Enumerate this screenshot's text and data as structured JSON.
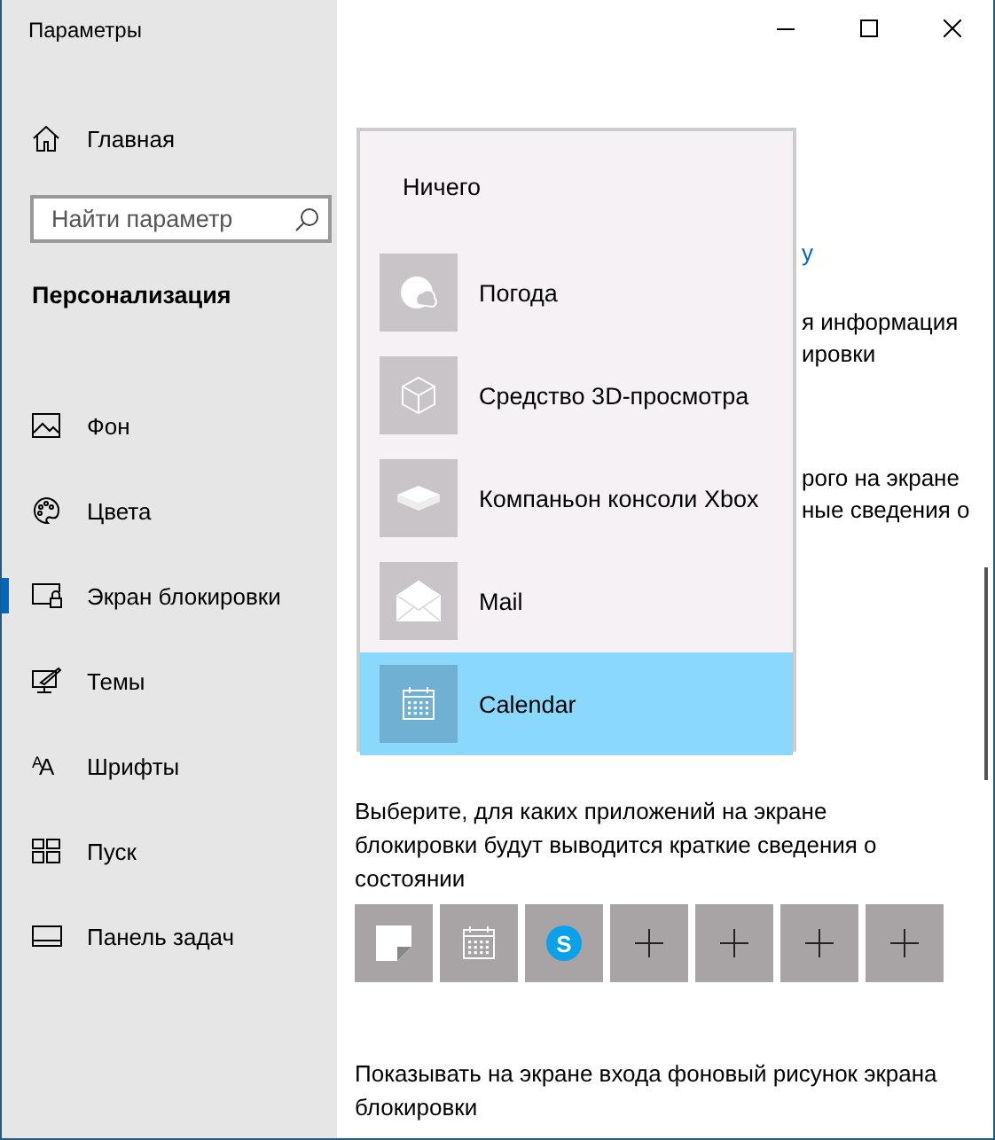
{
  "window": {
    "title": "Параметры"
  },
  "sidebar": {
    "home": {
      "label": "Главная"
    },
    "search": {
      "placeholder": "Найти параметр"
    },
    "section_title": "Персонализация",
    "items": [
      {
        "label": "Фон",
        "selected": false
      },
      {
        "label": "Цвета",
        "selected": false
      },
      {
        "label": "Экран блокировки",
        "selected": true
      },
      {
        "label": "Темы",
        "selected": false
      },
      {
        "label": "Шрифты",
        "selected": false,
        "glyph": "AA"
      },
      {
        "label": "Пуск",
        "selected": false
      },
      {
        "label": "Панель задач",
        "selected": false
      }
    ]
  },
  "content": {
    "link_fragment": "у",
    "fragments": [
      "я информация",
      "ировки",
      "рого на экране",
      "ные сведения о"
    ],
    "status_text": "Выберите, для каких приложений на экране блокировки будут выводится краткие сведения о состоянии",
    "status_tiles": [
      {
        "kind": "sticky"
      },
      {
        "kind": "calendar"
      },
      {
        "kind": "skype",
        "glyph": "S"
      },
      {
        "kind": "add"
      },
      {
        "kind": "add"
      },
      {
        "kind": "add"
      },
      {
        "kind": "add"
      }
    ],
    "signin_text": "Показывать на экране входа фоновый рисунок экрана блокировки"
  },
  "popup": {
    "items": [
      {
        "label": "Ничего",
        "kind": "none",
        "selected": false
      },
      {
        "label": "Погода",
        "kind": "weather",
        "selected": false
      },
      {
        "label": "Средство 3D-просмотра",
        "kind": "cube",
        "selected": false
      },
      {
        "label": "Компаньон консоли Xbox",
        "kind": "console",
        "selected": false
      },
      {
        "label": "Mail",
        "kind": "mail",
        "selected": false
      },
      {
        "label": "Calendar",
        "kind": "calendar",
        "selected": true
      }
    ]
  }
}
